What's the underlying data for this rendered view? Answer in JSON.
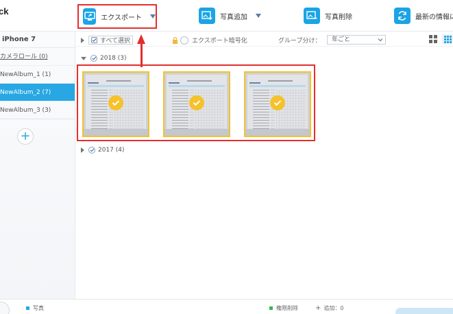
{
  "app": {
    "brand": "ck"
  },
  "toolbar": {
    "export_label": "エクスポート",
    "add_label": "写真追加",
    "delete_label": "写真削除",
    "refresh_label": "最新の情報に"
  },
  "sidebar": {
    "device": "iPhone 7",
    "items": [
      {
        "label": "カメラロール (0)"
      },
      {
        "label": "NewAlbum_1 (1)"
      },
      {
        "label": "NewAlbum_2 (7)"
      },
      {
        "label": "NewAlbum_3 (3)"
      }
    ]
  },
  "options": {
    "select_all": "すべて選択",
    "encrypt": "エクスポート暗号化",
    "group_label": "グループ分け：",
    "group_value": "年ごと"
  },
  "groups": [
    {
      "label": "2018 (3)",
      "expanded": true
    },
    {
      "label": "2017 (4)",
      "expanded": false
    }
  ],
  "thumbnails": {
    "count": 3,
    "selected": [
      true,
      true,
      true
    ]
  },
  "footer": {
    "photos": "写真",
    "delete_perm": "権限削除",
    "add_count": "追加：0"
  },
  "colors": {
    "accent": "#27a7e3",
    "highlight": "#e52d2d",
    "check": "#f5c22b"
  }
}
